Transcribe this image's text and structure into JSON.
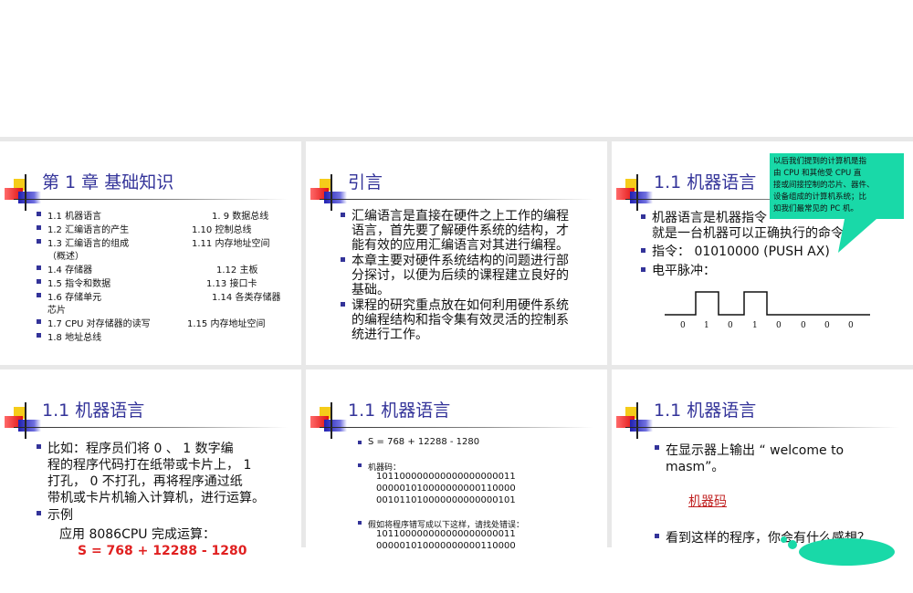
{
  "slide1": {
    "title": "第 1 章  基础知识",
    "left": [
      "1.1  机器语言",
      "1.2  汇编语言的产生",
      "1.3  汇编语言的组成",
      "（概述）",
      "1.4  存储器",
      "1.5  指令和数据",
      "1.6  存储单元",
      "芯片",
      "1.7 CPU 对存储器的读写",
      "1.8  地址总线"
    ],
    "right": [
      "1. 9  数据总线",
      "1.10  控制总线",
      "1.11  内存地址空间",
      "1.12  主板",
      "1.13  接口卡",
      "1.14  各类存储器",
      "1.15  内存地址空间"
    ]
  },
  "slide2": {
    "title": "引言",
    "lines": [
      "汇编语言是直接在硬件之上工作的编程",
      "语言，首先要了解硬件系统的结构，才",
      "能有效的应用汇编语言对其进行编程。",
      "本章主要对硬件系统结构的问题进行部",
      "分探讨，以便为后续的课程建立良好的",
      "基础。",
      "课程的研究重点放在如何利用硬件系统",
      "的编程结构和指令集有效灵活的控制系",
      "统进行工作。"
    ]
  },
  "slide3": {
    "title": "1.1  机器语言",
    "lines": [
      "机器语言是机器指令",
      "就是一台机器可以正确执行的命令",
      "指令：  01010000 (PUSH AX)",
      "电平脉冲："
    ],
    "callout": [
      "以后我们提到的计算机是指",
      "由 CPU  和其他受 CPU  直",
      "接或间接控制的芯片、器件、",
      "设备组成的计算机系统；比",
      "如我们最常见的 PC  机。"
    ],
    "bits": [
      "0",
      "1",
      "0",
      "1",
      "0",
      "0",
      "0",
      "0"
    ],
    "callout_color": "#19d9a8"
  },
  "slide4": {
    "title": "1.1  机器语言",
    "lines": [
      "比如：程序员们将   0 、 1  数字编",
      "程的程序代码打在纸带或卡片上， 1",
      "打孔， 0 不打孔，再将程序通过纸",
      "带机或卡片机输入计算机，进行运算。",
      "示例",
      "应用 8086CPU 完成运算：",
      "S = 768 + 12288 - 1280"
    ]
  },
  "slide5": {
    "title": "1.1  机器语言",
    "lines": [
      "S = 768 + 12288 - 1280",
      "机器码：",
      "101100000000000000000011",
      "000001010000000000110000",
      "001011010000000000000101",
      "假如将程序错写成以下这样，请找处错误：",
      "101100000000000000000011",
      "000001010000000000110000"
    ]
  },
  "slide6": {
    "title": "1.1  机器语言",
    "lines": [
      "在显示器上输出 “ welcome to",
      "masm”。",
      "机器码",
      "看到这样的程序，你会有什么感想？"
    ]
  }
}
